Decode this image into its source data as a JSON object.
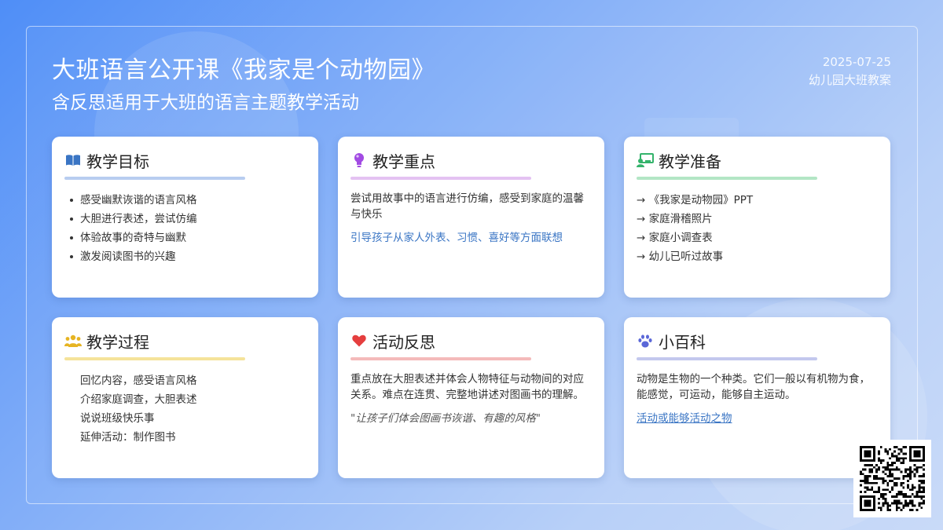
{
  "header": {
    "title": "大班语言公开课《我家是个动物园》",
    "subtitle": "含反思适用于大班的语言主题教学活动",
    "date": "2025-07-25",
    "category": "幼儿园大班教案"
  },
  "cards": {
    "goals": {
      "title": "教学目标",
      "icon": "book-icon",
      "accent": "#3a75c4",
      "items": [
        "感受幽默诙谐的语言风格",
        "大胆进行表述，尝试仿编",
        "体验故事的奇特与幽默",
        "激发阅读图书的兴趣"
      ]
    },
    "focus": {
      "title": "教学重点",
      "icon": "lightbulb-icon",
      "accent": "#a24be3",
      "text": "尝试用故事中的语言进行仿编，感受到家庭的温馨与快乐",
      "highlight": "引导孩子从家人外表、习惯、喜好等方面联想"
    },
    "prep": {
      "title": "教学准备",
      "icon": "presentation-icon",
      "accent": "#34b36b",
      "items": [
        "→ 《我家是动物园》PPT",
        "→ 家庭滑稽照片",
        "→ 家庭小调查表",
        "→ 幼儿已听过故事"
      ]
    },
    "process": {
      "title": "教学过程",
      "icon": "people-icon",
      "accent": "#e6b422",
      "items": [
        "回忆内容，感受语言风格",
        "介绍家庭调查，大胆表述",
        "说说班级快乐事",
        "延伸活动：制作图书"
      ]
    },
    "reflection": {
      "title": "活动反思",
      "icon": "heart-icon",
      "accent": "#e53e3e",
      "text": "重点放在大胆表述并体会人物特征与动物间的对应关系。难点在连贯、完整地讲述对图画书的理解。",
      "quote": "\"让孩子们体会图画书诙谐、有趣的风格\""
    },
    "wiki": {
      "title": "小百科",
      "icon": "paw-icon",
      "accent": "#5a67d8",
      "text": "动物是生物的一个种类。它们一般以有机物为食，能感觉，可运动，能够自主运动。",
      "link": "活动或能够活动之物"
    }
  },
  "qr": {
    "icon": "qr-code-icon"
  }
}
